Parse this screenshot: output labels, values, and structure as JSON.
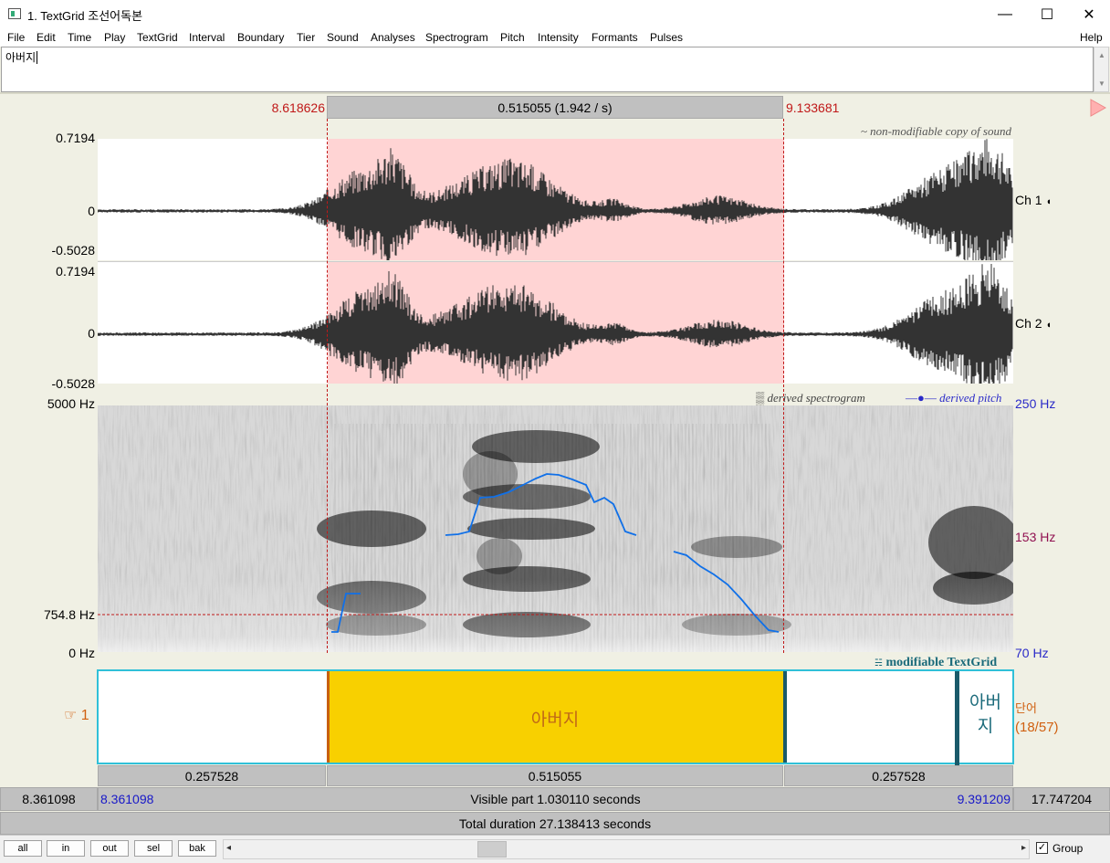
{
  "window": {
    "title": "1. TextGrid 조선어독본",
    "minimize_glyph": "—",
    "maximize_glyph": "☐",
    "close_glyph": "✕"
  },
  "menu": [
    "File",
    "Edit",
    "Time",
    "Play",
    "TextGrid",
    "Interval",
    "Boundary",
    "Tier",
    "Sound",
    "Analyses",
    "Spectrogram",
    "Pitch",
    "Intensity",
    "Formants",
    "Pulses"
  ],
  "menu_help": "Help",
  "text_field": {
    "value": "아버지"
  },
  "selection": {
    "start": "8.618626",
    "end": "9.133681",
    "duration": "0.515055 (1.942 / s)"
  },
  "waveform": {
    "note": "~ non-modifiable copy of sound",
    "ch1": {
      "max": "0.7194",
      "zero": "0",
      "min": "-0.5028",
      "label": "Ch 1"
    },
    "ch2": {
      "max": "0.7194",
      "zero": "0",
      "min": "-0.5028",
      "label": "Ch 2"
    }
  },
  "spectrogram": {
    "top": "5000 Hz",
    "bottom": "0 Hz",
    "cursor": "754.8 Hz",
    "legend_spec": "derived spectrogram",
    "legend_pitch": "derived pitch",
    "pitch_top": "250 Hz",
    "pitch_mid": "153 Hz",
    "pitch_bottom": "70 Hz"
  },
  "textgrid": {
    "note": "modifiable TextGrid",
    "tier_number": "1",
    "tier_name": "단어",
    "tier_count": "(18/57)",
    "intervals": [
      {
        "text": ""
      },
      {
        "text": "아버지"
      },
      {
        "text": ""
      },
      {
        "text": "아버\n지"
      }
    ]
  },
  "durations": [
    "0.257528",
    "0.515055",
    "0.257528"
  ],
  "visible": {
    "left_outer": "8.361098",
    "left": "8.361098",
    "label": "Visible part 1.030110 seconds",
    "right": "9.391209",
    "right_outer": "17.747204"
  },
  "total": "Total duration 27.138413 seconds",
  "buttons": {
    "all": "all",
    "in": "in",
    "out": "out",
    "sel": "sel",
    "bak": "bak"
  },
  "group_label": "Group",
  "colors": {
    "selection": "#ffd4d4",
    "interval_selected": "#f8d000",
    "tier_border": "#30c0d8",
    "pitch": "#1070e8",
    "red": "#c01818"
  }
}
